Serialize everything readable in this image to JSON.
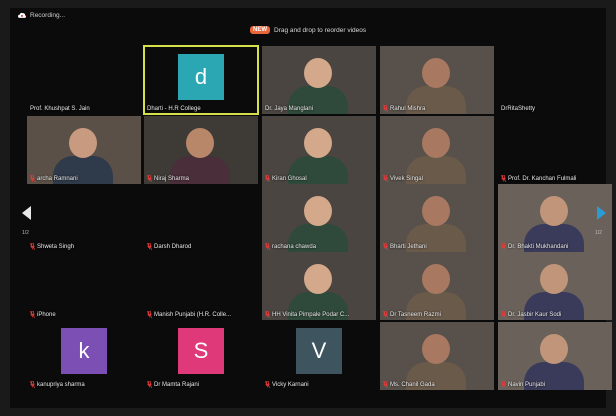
{
  "status": {
    "recording": "Recording..."
  },
  "hint": {
    "badge": "NEW",
    "text": "Drag and drop to reorder videos"
  },
  "pager": {
    "left": "1/2",
    "right": "1/2"
  },
  "colors": {
    "active_border": "#d6e04a",
    "badge": "#e8663a",
    "right_arrow": "#2b9bd6",
    "muted_mic": "#e23a3a"
  },
  "participants": [
    {
      "name": "Prof. Khushpat S. Jain",
      "muted": false
    },
    {
      "name": "Dharti - H.R College",
      "muted": false,
      "avatar": "d",
      "avatar_color": "#2aa7b3",
      "active": true
    },
    {
      "name": "Dr. Jaya Manglani",
      "muted": false
    },
    {
      "name": "Rahul Mishra",
      "muted": true
    },
    {
      "name": "DrRitaShetty",
      "muted": false
    },
    {
      "name": "archa Ramnani",
      "muted": true
    },
    {
      "name": "Niraj Sharma",
      "muted": true
    },
    {
      "name": "Kiran Ghosal",
      "muted": true
    },
    {
      "name": "Vivek Singal",
      "muted": true
    },
    {
      "name": "Prof. Dr. Kanchan Fulmali",
      "muted": true
    },
    {
      "name": "Shweta Singh",
      "muted": true
    },
    {
      "name": "Darsh Dharod",
      "muted": true
    },
    {
      "name": "rachana chawda",
      "muted": true
    },
    {
      "name": "Bharti Jethani",
      "muted": true
    },
    {
      "name": "Dr. Bhakti Mukhandani",
      "muted": true
    },
    {
      "name": "iPhone",
      "muted": true
    },
    {
      "name": "Manish Punjabi (H.R. Colle...",
      "muted": true
    },
    {
      "name": "HH Vinita Pimpale Podar C...",
      "muted": true
    },
    {
      "name": "Dr Tasneem Razmi",
      "muted": true
    },
    {
      "name": "Dr. Jasbir Kaur Sodi",
      "muted": true
    },
    {
      "name": "kanupriya sharma",
      "muted": true,
      "avatar": "k",
      "avatar_color": "#7b4fb3"
    },
    {
      "name": "Dr Mamta Rajani",
      "muted": true,
      "avatar": "S",
      "avatar_color": "#e0397a"
    },
    {
      "name": "Vicky Karnani",
      "muted": true,
      "avatar": "V",
      "avatar_color": "#3e5560"
    },
    {
      "name": "Ms. Chanil Gada",
      "muted": true
    },
    {
      "name": "Navin Punjabi",
      "muted": true
    }
  ]
}
